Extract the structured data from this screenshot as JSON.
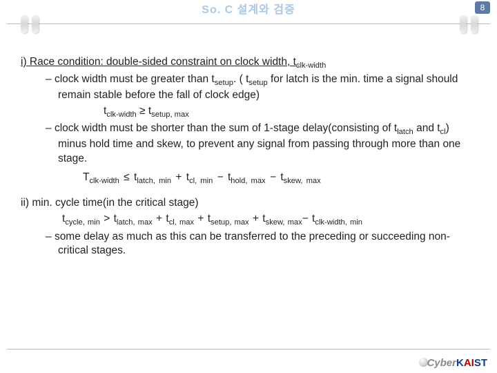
{
  "page_number": "8",
  "title": "So. C  설계와  검증",
  "section1": {
    "heading_pre": "i) ",
    "heading_text_plain": "",
    "line1_a": "clock width must be greater than t",
    "line1_b": ". ( t",
    "line1_c": " for latch is the min. time a signal should remain stable before the fall of clock edge)",
    "formula1_lhs": "t",
    "formula1_sub_lhs": "clk-width",
    "formula1_op": "   ≥   ",
    "formula1_rhs": "t",
    "formula1_sub_rhs": "setup, max",
    "line2_a": "clock width must be shorter than the sum of 1-stage delay(consisting of t",
    "line2_b": " and t",
    "line2_c": ") minus hold time and skew, to prevent any signal from passing through more than one stage."
  },
  "formula2": {
    "T": "T",
    "sub1": "clk-width",
    "op1": "  ≤   ",
    "t1": "t",
    "s1": "latch, min",
    "plus1": " + ",
    "t2": "t",
    "s2": "cl, min",
    "minus1": " − ",
    "t3": "t",
    "s3": "hold, max",
    "minus2": " − ",
    "t4": "t",
    "s4": "skew, max"
  },
  "section2": {
    "heading": "ii) min. cycle time(in the critical stage)",
    "f_t": "t",
    "f_s": "cycle, min",
    "f_gt": " > ",
    "f_t1": "t",
    "f_s1": "latch, max",
    "plus1": " + ",
    "f_t2": "t",
    "f_s2": "cl, max",
    "plus2": " + ",
    "f_t3": "t",
    "f_s3": "setup, max",
    "plus3": " + ",
    "f_t4": "t",
    "f_s4": "skew, max",
    "minus": "− ",
    "f_t5": "t",
    "f_s5": "clk-width, min",
    "bullet": "some delay as much as this can be transferred to the preceding or succeeding non-critical stages."
  },
  "logo": {
    "cy": "Cy",
    "ber": "ber",
    "k": "K",
    "ai": "AI",
    "st": "ST"
  }
}
